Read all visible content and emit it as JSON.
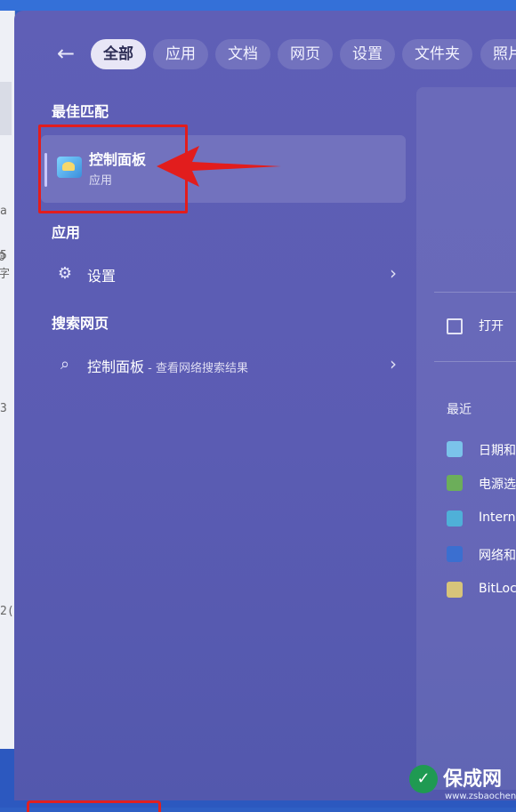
{
  "filters": {
    "back_icon": "arrow-left-icon",
    "chips": [
      "全部",
      "应用",
      "文档",
      "网页",
      "设置",
      "文件夹",
      "照片"
    ],
    "active_index": 0
  },
  "best_match": {
    "heading": "最佳匹配",
    "app_name": "控制面板",
    "app_type": "应用",
    "icon": "control-panel-icon"
  },
  "apps_section": {
    "heading": "应用",
    "items": [
      {
        "label": "设置",
        "icon": "gear-icon"
      }
    ]
  },
  "web_section": {
    "heading": "搜索网页",
    "items": [
      {
        "label": "控制面板",
        "sub": " - 查看网络搜索结果",
        "icon": "search-icon"
      }
    ]
  },
  "details": {
    "open_label": "打开",
    "recent_title": "最近",
    "recent_items": [
      {
        "label": "日期和",
        "icon": "date-time-icon",
        "color": "#7bc3ea"
      },
      {
        "label": "电源选",
        "icon": "power-options-icon",
        "color": "#6cae5a"
      },
      {
        "label": "Intern",
        "icon": "internet-options-icon",
        "color": "#4fb0d8"
      },
      {
        "label": "网络和",
        "icon": "network-icon",
        "color": "#3b6fd0"
      },
      {
        "label": "BitLoc",
        "icon": "bitlocker-icon",
        "color": "#d7c47a"
      }
    ]
  },
  "background": {
    "left_fragments": [
      "a",
      "5",
      "0字",
      "3",
      "2("
    ]
  },
  "watermark": {
    "title": "保成网",
    "url": "www.zsbaocheng.net"
  },
  "colors": {
    "panel": "#5b5cb3",
    "highlight": "#e21d1d"
  }
}
